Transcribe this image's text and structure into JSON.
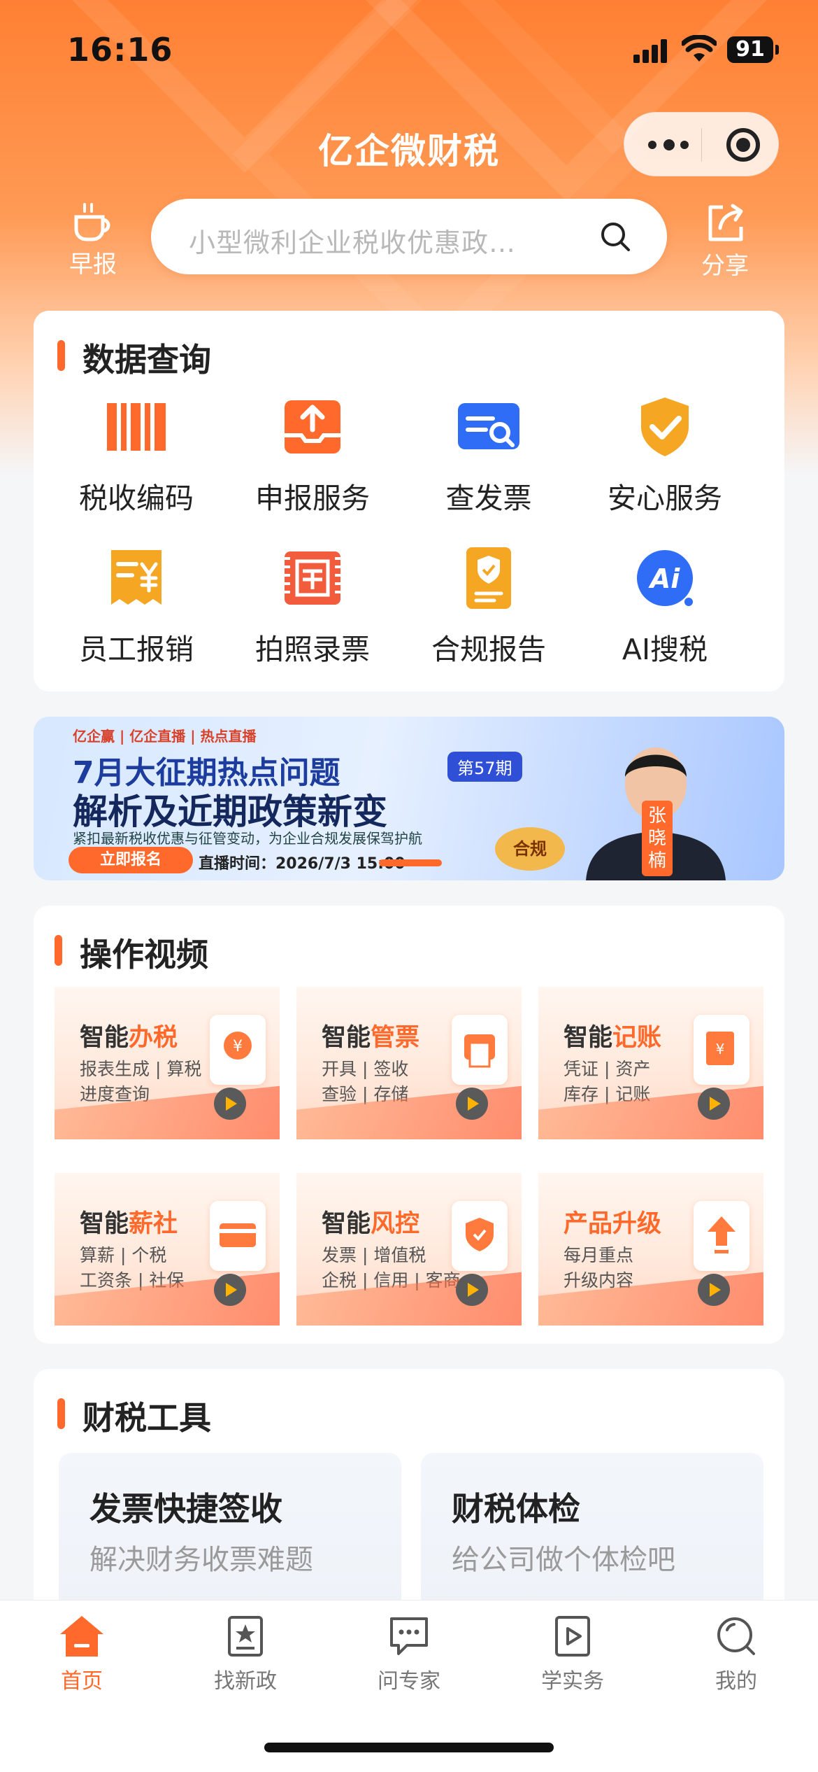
{
  "status_bar": {
    "time": "16:16",
    "battery": "91"
  },
  "header": {
    "app_title": "亿企微财税",
    "left_button_label": "早报",
    "right_button_label": "分享",
    "search_placeholder": "小型微利企业税收优惠政…"
  },
  "data_query": {
    "title": "数据查询",
    "items": [
      {
        "label": "税收编码",
        "icon": "barcode-icon"
      },
      {
        "label": "申报服务",
        "icon": "upload-tray-icon"
      },
      {
        "label": "查发票",
        "icon": "invoice-search-icon"
      },
      {
        "label": "安心服务",
        "icon": "shield-check-icon"
      },
      {
        "label": "员工报销",
        "icon": "receipt-yen-icon"
      },
      {
        "label": "拍照录票",
        "icon": "ticket-scan-icon"
      },
      {
        "label": "合规报告",
        "icon": "report-badge-icon"
      },
      {
        "label": "AI搜税",
        "icon": "ai-icon"
      }
    ]
  },
  "banner": {
    "brand": "亿企赢 | 亿企直播 | 热点直播",
    "line1": "7月大征期热点问题",
    "issue_tag": "第57期",
    "line2": "解析及近期政策新变",
    "line3": "紧扣最新税收优惠与征管变动，为企业合规发展保驾护航",
    "button": "立即报名",
    "time": "直播时间：2026/7/3 15:00",
    "speaker": "张晓楠",
    "seal": "合规"
  },
  "videos": {
    "title": "操作视频",
    "items": [
      {
        "title_a": "智能",
        "title_b": "办税",
        "line1": "报表生成 | 算税",
        "line2": "进度查询"
      },
      {
        "title_a": "智能",
        "title_b": "管票",
        "line1": "开具 | 签收",
        "line2": "查验 | 存储"
      },
      {
        "title_a": "智能",
        "title_b": "记账",
        "line1": "凭证 | 资产",
        "line2": "库存 | 记账"
      },
      {
        "title_a": "智能",
        "title_b": "薪社",
        "line1": "算薪 | 个税",
        "line2": "工资条 | 社保"
      },
      {
        "title_a": "智能",
        "title_b": "风控",
        "line1": "发票 | 增值税",
        "line2": "企税 | 信用 | 客商"
      },
      {
        "title_a": "",
        "title_b": "产品升级",
        "line1": "每月重点",
        "line2": "升级内容"
      }
    ]
  },
  "tools": {
    "title": "财税工具",
    "items": [
      {
        "title": "发票快捷签收",
        "subtitle": "解决财务收票难题"
      },
      {
        "title": "财税体检",
        "subtitle": "给公司做个体检吧"
      }
    ]
  },
  "tabbar": {
    "items": [
      {
        "label": "首页",
        "active": true
      },
      {
        "label": "找新政"
      },
      {
        "label": "问专家"
      },
      {
        "label": "学实务"
      },
      {
        "label": "我的"
      }
    ]
  },
  "colors": {
    "accent": "#ff6a2c",
    "header": "#ff8033",
    "blue": "#2f6df6",
    "gold": "#f5a623"
  }
}
